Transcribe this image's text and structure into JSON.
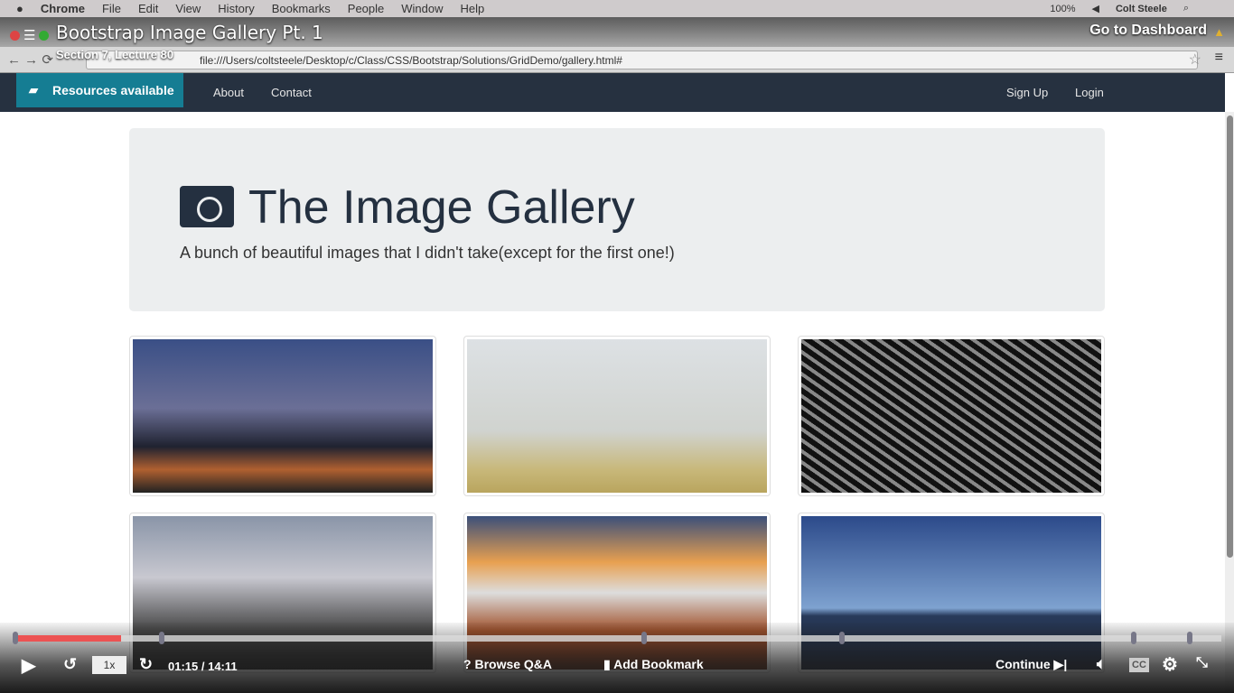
{
  "os_menu": {
    "app": "Chrome",
    "items": [
      "File",
      "Edit",
      "View",
      "History",
      "Bookmarks",
      "People",
      "Window",
      "Help"
    ],
    "battery": "100%",
    "user": "Colt Steele"
  },
  "browser": {
    "url": "file:///Users/coltsteele/Desktop/c/Class/CSS/Bootstrap/Solutions/GridDemo/gallery.html#"
  },
  "site": {
    "nav_left": [
      "About",
      "Contact"
    ],
    "nav_right": [
      "Sign Up",
      "Login"
    ],
    "heading": "The Image Gallery",
    "subheading": "A bunch of beautiful images that I didn't take(except for the first one!)"
  },
  "player": {
    "title": "Bootstrap Image Gallery Pt. 1",
    "subtitle": "Section 7, Lecture 80",
    "dashboard": "Go to Dashboard",
    "resources": "Resources available",
    "speed": "1x",
    "time": "01:15 / 14:11",
    "progress_percent": 8.8,
    "browse_qa": "Browse Q&A",
    "add_bookmark": "Add Bookmark",
    "continue": "Continue",
    "cc": "CC",
    "accent": "#ec5252"
  }
}
